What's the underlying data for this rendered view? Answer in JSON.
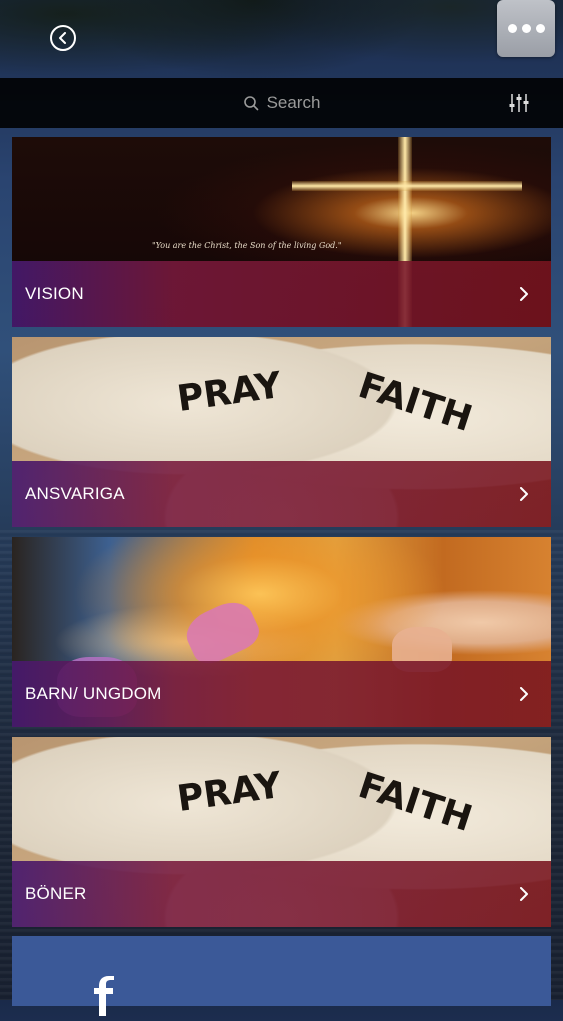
{
  "nav": {
    "back_icon": "chevron-left-circle-icon",
    "more_icon": "ellipsis-icon"
  },
  "search": {
    "placeholder": "Search",
    "filter_icon": "sliders-icon"
  },
  "tiles": [
    {
      "label": "VISION",
      "quote": "\"You are the Christ, the Son of the living God.\""
    },
    {
      "label": "ANSVARIGA",
      "words": [
        "PRAY",
        "FAITH"
      ]
    },
    {
      "label": "BARN/ UNGDOM"
    },
    {
      "label": "BÖNER",
      "words": [
        "PRAY",
        "FAITH"
      ]
    }
  ],
  "colors": {
    "facebook": "#3b5998",
    "bar_red": "#78141e",
    "bar_purple": "#461966"
  }
}
